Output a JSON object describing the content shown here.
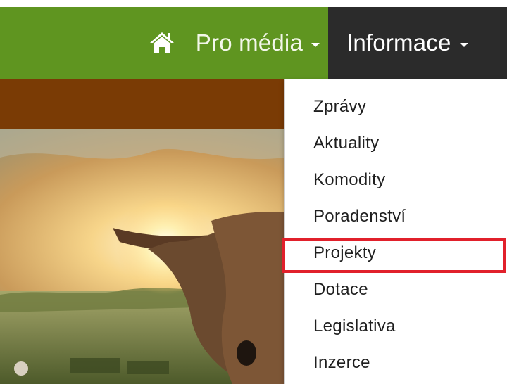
{
  "nav": {
    "home_icon": "home-icon",
    "pro_media_label": "Pro média",
    "informace_label": "Informace",
    "colors": {
      "green": "#5f9520",
      "dark": "#2b2b2b",
      "brown": "#7a3b05"
    }
  },
  "dropdown": {
    "items": [
      {
        "label": "Zprávy"
      },
      {
        "label": "Aktuality"
      },
      {
        "label": "Komodity"
      },
      {
        "label": "Poradenství"
      },
      {
        "label": "Projekty",
        "highlighted": true
      },
      {
        "label": "Dotace"
      },
      {
        "label": "Legislativa"
      },
      {
        "label": "Inzerce"
      }
    ],
    "highlight_color": "#e1202b"
  },
  "hero": {
    "image": "cow-in-sunset-field"
  }
}
